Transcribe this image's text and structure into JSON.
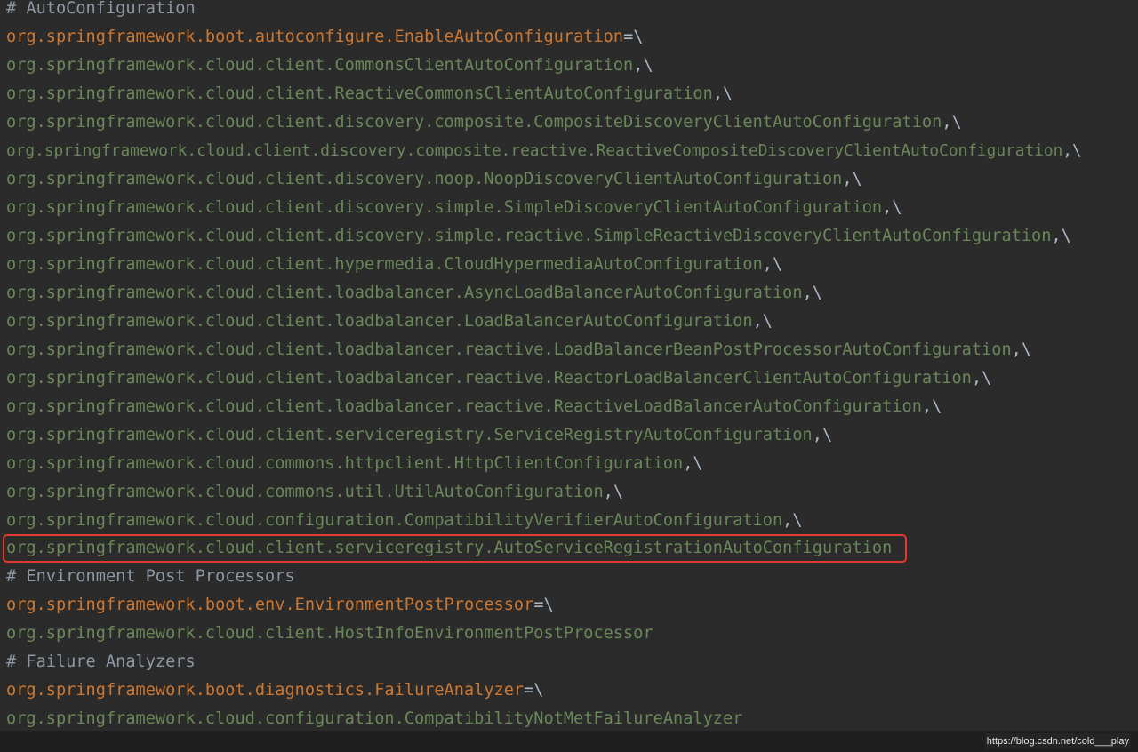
{
  "editor": {
    "lines": [
      {
        "type": "comment",
        "text": "# AutoConfiguration"
      },
      {
        "type": "key",
        "text": "org.springframework.boot.autoconfigure.EnableAutoConfiguration",
        "suffix": "=\\"
      },
      {
        "type": "val",
        "text": "org.springframework.cloud.client.CommonsClientAutoConfiguration",
        "suffix": ",\\"
      },
      {
        "type": "val",
        "text": "org.springframework.cloud.client.ReactiveCommonsClientAutoConfiguration",
        "suffix": ",\\"
      },
      {
        "type": "val",
        "text": "org.springframework.cloud.client.discovery.composite.CompositeDiscoveryClientAutoConfiguration",
        "suffix": ",\\"
      },
      {
        "type": "val",
        "text": "org.springframework.cloud.client.discovery.composite.reactive.ReactiveCompositeDiscoveryClientAutoConfiguration",
        "suffix": ",\\"
      },
      {
        "type": "val",
        "text": "org.springframework.cloud.client.discovery.noop.NoopDiscoveryClientAutoConfiguration",
        "suffix": ",\\"
      },
      {
        "type": "val",
        "text": "org.springframework.cloud.client.discovery.simple.SimpleDiscoveryClientAutoConfiguration",
        "suffix": ",\\"
      },
      {
        "type": "val",
        "text": "org.springframework.cloud.client.discovery.simple.reactive.SimpleReactiveDiscoveryClientAutoConfiguration",
        "suffix": ",\\"
      },
      {
        "type": "val",
        "text": "org.springframework.cloud.client.hypermedia.CloudHypermediaAutoConfiguration",
        "suffix": ",\\"
      },
      {
        "type": "val",
        "text": "org.springframework.cloud.client.loadbalancer.AsyncLoadBalancerAutoConfiguration",
        "suffix": ",\\"
      },
      {
        "type": "val",
        "text": "org.springframework.cloud.client.loadbalancer.LoadBalancerAutoConfiguration",
        "suffix": ",\\"
      },
      {
        "type": "val",
        "text": "org.springframework.cloud.client.loadbalancer.reactive.LoadBalancerBeanPostProcessorAutoConfiguration",
        "suffix": ",\\"
      },
      {
        "type": "val",
        "text": "org.springframework.cloud.client.loadbalancer.reactive.ReactorLoadBalancerClientAutoConfiguration",
        "suffix": ",\\"
      },
      {
        "type": "val",
        "text": "org.springframework.cloud.client.loadbalancer.reactive.ReactiveLoadBalancerAutoConfiguration",
        "suffix": ",\\"
      },
      {
        "type": "val",
        "text": "org.springframework.cloud.client.serviceregistry.ServiceRegistryAutoConfiguration",
        "suffix": ",\\"
      },
      {
        "type": "val",
        "text": "org.springframework.cloud.commons.httpclient.HttpClientConfiguration",
        "suffix": ",\\"
      },
      {
        "type": "val",
        "text": "org.springframework.cloud.commons.util.UtilAutoConfiguration",
        "suffix": ",\\"
      },
      {
        "type": "val",
        "text": "org.springframework.cloud.configuration.CompatibilityVerifierAutoConfiguration",
        "suffix": ",\\"
      },
      {
        "type": "val",
        "text": "org.springframework.cloud.client.serviceregistry.AutoServiceRegistrationAutoConfiguration",
        "suffix": ""
      },
      {
        "type": "comment",
        "text": "# Environment Post Processors"
      },
      {
        "type": "key",
        "text": "org.springframework.boot.env.EnvironmentPostProcessor",
        "suffix": "=\\"
      },
      {
        "type": "val",
        "text": "org.springframework.cloud.client.HostInfoEnvironmentPostProcessor",
        "suffix": ""
      },
      {
        "type": "comment",
        "text": "# Failure Analyzers"
      },
      {
        "type": "key",
        "text": "org.springframework.boot.diagnostics.FailureAnalyzer",
        "suffix": "=\\"
      },
      {
        "type": "val",
        "text": "org.springframework.cloud.configuration.CompatibilityNotMetFailureAnalyzer",
        "suffix": ""
      }
    ]
  },
  "colors": {
    "background": "#2b2b2b",
    "comment": "#a9b7c6",
    "key": "#cc7832",
    "value": "#6a8759",
    "highlight": "#e23a2e"
  },
  "watermark": "https://blog.csdn.net/cold___play"
}
